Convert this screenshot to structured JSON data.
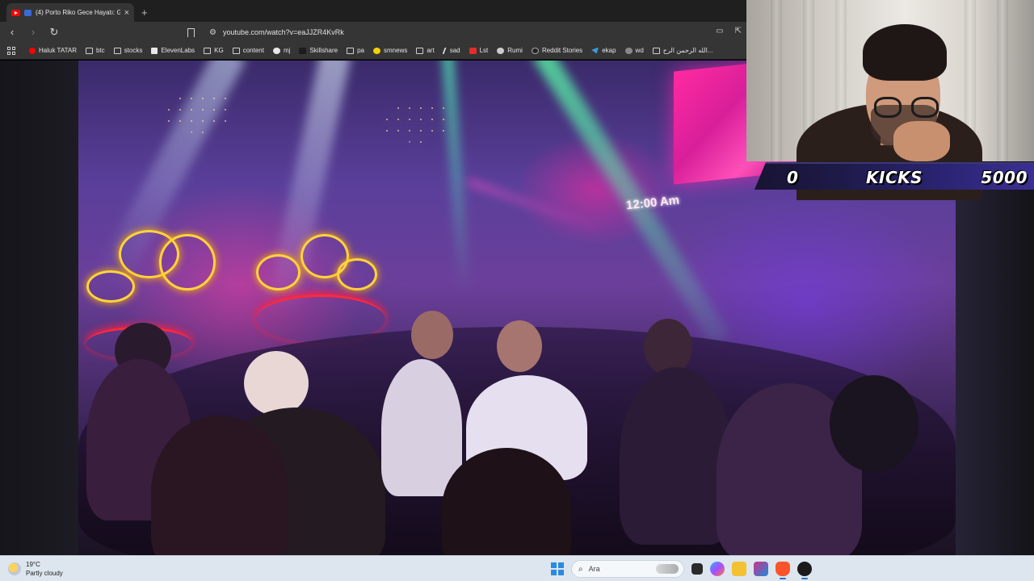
{
  "browser": {
    "tab": {
      "title": "(4) Porto Riko Gece Hayatı: G",
      "close_icon": "close-icon",
      "new_tab_label": "+"
    },
    "toolbar": {
      "back_icon": "chevron-left-icon",
      "forward_icon": "chevron-right-icon",
      "reload_icon": "reload-icon",
      "url": "youtube.com/watch?v=eaJJZR4KvRk"
    },
    "bookmarks": [
      {
        "label": "Haluk TATAR",
        "icon": "youtube-icon"
      },
      {
        "label": "btc",
        "icon": "folder-icon"
      },
      {
        "label": "stocks",
        "icon": "folder-icon"
      },
      {
        "label": "ElevenLabs",
        "icon": "elevenlabs-icon"
      },
      {
        "label": "KG",
        "icon": "folder-icon"
      },
      {
        "label": "content",
        "icon": "folder-icon"
      },
      {
        "label": "mj",
        "icon": "github-icon"
      },
      {
        "label": "Skillshare",
        "icon": "skillshare-icon"
      },
      {
        "label": "pa",
        "icon": "folder-icon"
      },
      {
        "label": "smnews",
        "icon": "smiley-icon"
      },
      {
        "label": "art",
        "icon": "folder-icon"
      },
      {
        "label": "sad",
        "icon": "slash-icon"
      },
      {
        "label": "Lst",
        "icon": "s-logo-icon"
      },
      {
        "label": "Rumi",
        "icon": "rumi-icon"
      },
      {
        "label": "Reddit Stories",
        "icon": "reddit-icon"
      },
      {
        "label": "ekap",
        "icon": "bird-icon"
      },
      {
        "label": "wd",
        "icon": "globe-icon"
      },
      {
        "label": "الله الرحمن الرح...",
        "icon": "document-icon"
      }
    ]
  },
  "video": {
    "clock_text": "12:00 Am"
  },
  "overlay": {
    "left_value": "0",
    "label": "KICKS",
    "right_value": "5000"
  },
  "taskbar": {
    "weather_temp": "19°C",
    "weather_desc": "Partly cloudy",
    "search_placeholder": "Ara",
    "icons": [
      "windows-start-icon",
      "task-view-icon",
      "copilot-icon",
      "file-explorer-icon",
      "snipping-tool-icon",
      "brave-browser-icon",
      "obs-icon"
    ]
  }
}
